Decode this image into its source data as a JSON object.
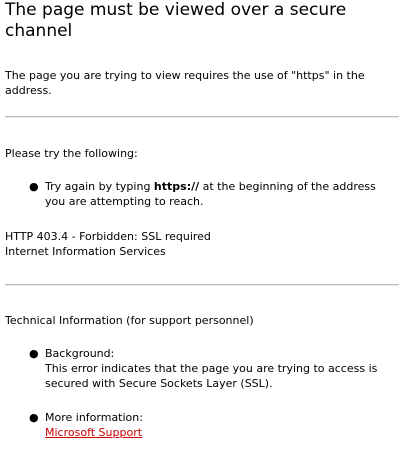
{
  "page": {
    "title": "The page must be viewed over a secure channel",
    "intro": "The page you are trying to view requires the use of \"https\" in the address.",
    "try_heading": "Please try the following:",
    "try_item_prefix": "Try again by typing ",
    "try_item_bold": "https://",
    "try_item_suffix": " at the beginning of the address you are attempting to reach.",
    "error_code": "HTTP 403.4 - Forbidden: SSL required",
    "error_source": "Internet Information Services",
    "tech_heading": "Technical Information (for support personnel)",
    "background_label": "Background:",
    "background_text": "This error indicates that the page you are trying to access is secured with Secure Sockets Layer (SSL).",
    "more_info_label": "More information:",
    "more_info_link": "Microsoft Support"
  },
  "colors": {
    "link": "#cc0000",
    "rule": "#bfbfbf",
    "text": "#000000",
    "background": "#ffffff"
  },
  "icons": {
    "bullet": "bullet-icon"
  }
}
